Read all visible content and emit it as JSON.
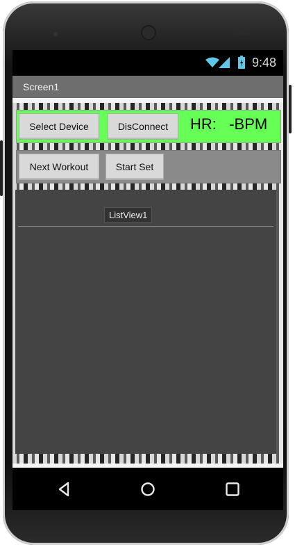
{
  "status": {
    "time": "9:48"
  },
  "app": {
    "title": "Screen1"
  },
  "row1": {
    "select_device": "Select Device",
    "disconnect": "DisConnect",
    "hr_text": "HR:   -BPM"
  },
  "row2": {
    "next_workout": "Next Workout",
    "start_set": "Start Set"
  },
  "listview": {
    "label": "ListView1"
  },
  "colors": {
    "hr_panel": "#66ff55",
    "listview_bg": "#444444",
    "titlebar": "#6e6e6e"
  },
  "icons": [
    "wifi-icon",
    "signal-icon",
    "battery-icon",
    "back-icon",
    "home-icon",
    "recents-icon"
  ]
}
